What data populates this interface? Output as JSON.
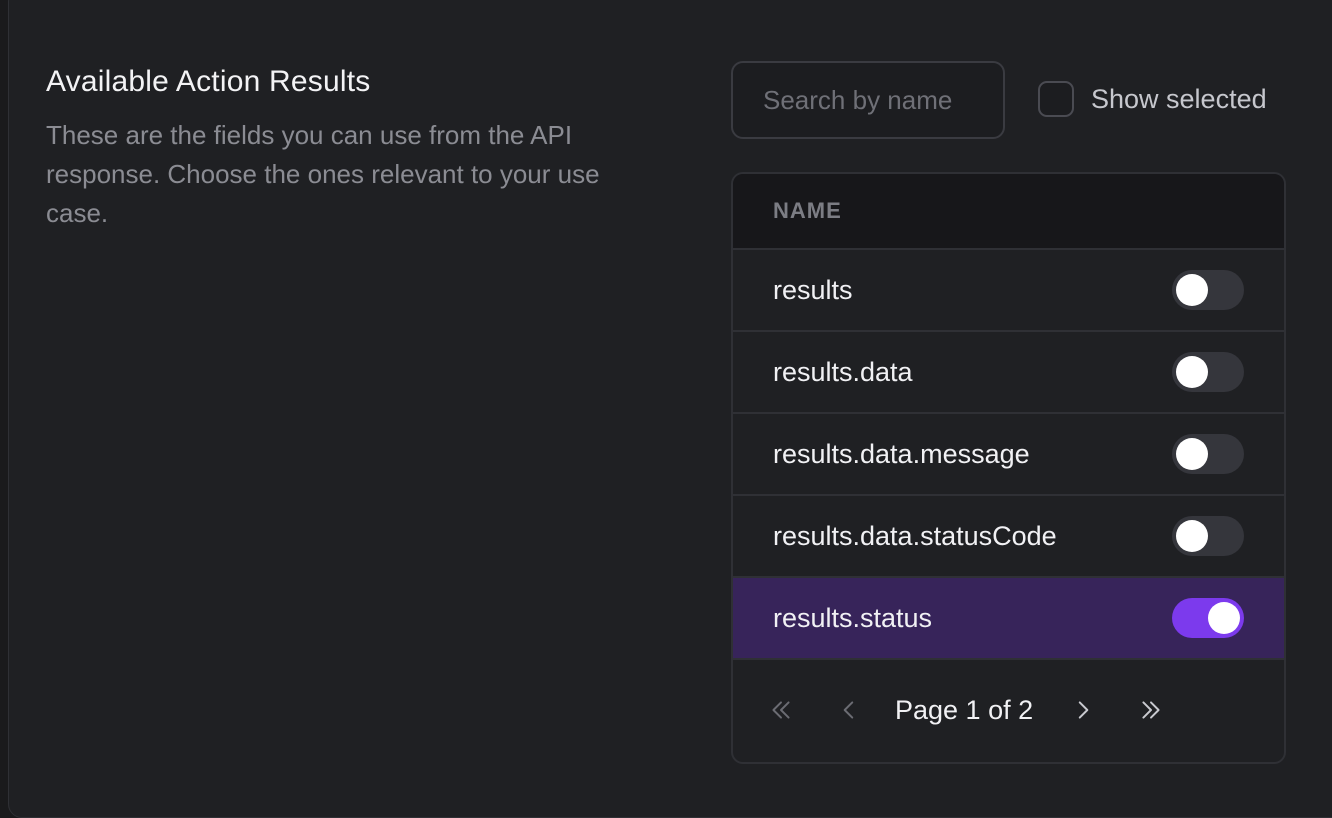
{
  "section": {
    "title": "Available Action Results",
    "description": "These are the fields you can use from the API response. Choose the ones relevant to your use case."
  },
  "search": {
    "placeholder": "Search by name",
    "value": ""
  },
  "show_selected": {
    "label": "Show selected",
    "checked": false
  },
  "table": {
    "column_header": "NAME",
    "rows": [
      {
        "name": "results",
        "enabled": false
      },
      {
        "name": "results.data",
        "enabled": false
      },
      {
        "name": "results.data.message",
        "enabled": false
      },
      {
        "name": "results.data.statusCode",
        "enabled": false
      },
      {
        "name": "results.status",
        "enabled": true
      }
    ]
  },
  "pagination": {
    "label": "Page 1 of 2",
    "current": 1,
    "total": 2
  },
  "colors": {
    "accent": "#7c3aed",
    "selected_row": "#37245a"
  },
  "icons": [
    "chevrons-left-icon",
    "chevron-left-icon",
    "chevron-right-icon",
    "chevrons-right-icon"
  ]
}
